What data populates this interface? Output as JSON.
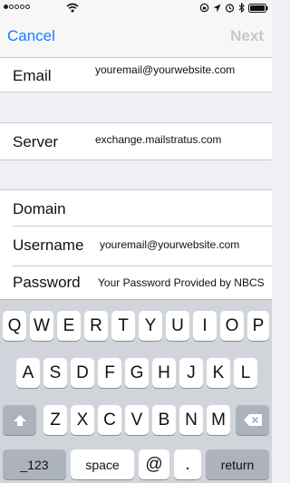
{
  "nav": {
    "cancel_label": "Cancel",
    "next_label": "Next"
  },
  "form": {
    "email": {
      "label": "Email",
      "value": "youremail@yourwebsite.com"
    },
    "server": {
      "label": "Server",
      "value": "exchange.mailstratus.com"
    },
    "domain": {
      "label": "Domain",
      "value": ""
    },
    "username": {
      "label": "Username",
      "value": "youremail@yourwebsite.com"
    },
    "password": {
      "label": "Password",
      "value": "Your Password Provided by NBCS"
    }
  },
  "keyboard": {
    "row1": [
      "Q",
      "W",
      "E",
      "R",
      "T",
      "Y",
      "U",
      "I",
      "O",
      "P"
    ],
    "row2": [
      "A",
      "S",
      "D",
      "F",
      "G",
      "H",
      "J",
      "K",
      "L"
    ],
    "row3": [
      "Z",
      "X",
      "C",
      "V",
      "B",
      "N",
      "M"
    ],
    "numbers_label": "_123",
    "space_label": "space",
    "at_label": "@",
    "dot_label": ".",
    "return_label": "return"
  },
  "icons": [
    "wifi-icon",
    "rotation-lock-icon",
    "location-icon",
    "alarm-icon",
    "bluetooth-icon",
    "battery-icon",
    "shift-icon",
    "delete-icon"
  ]
}
